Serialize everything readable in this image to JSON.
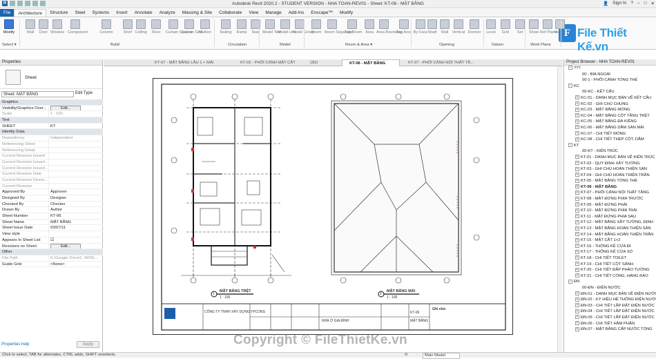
{
  "window": {
    "title": "Autodesk Revit 2020.2 - STUDENT VERSION - NHA TOAN-REV01 - Sheet: KT-06 - MẶT BẰNG",
    "sign_in": "Sign In"
  },
  "menu": [
    "File",
    "Architecture",
    "Structure",
    "Steel",
    "Systems",
    "Insert",
    "Annotate",
    "Analyze",
    "Massing & Site",
    "Collaborate",
    "View",
    "Manage",
    "Add-Ins",
    "Enscape™",
    "Modify"
  ],
  "ribbon": {
    "tools": [
      "Modify",
      "Wall",
      "Door",
      "Window",
      "Component",
      "Column",
      "Roof",
      "Ceiling",
      "Floor",
      "Curtain System",
      "Curtain Grid",
      "Mullion",
      "Railing",
      "Ramp",
      "Stair",
      "Model Text",
      "Model Line",
      "Model Group",
      "Room",
      "Room Separator",
      "Tag Room",
      "Area",
      "Area Boundary",
      "Tag Area",
      "By Face",
      "Shaft",
      "Wall",
      "Vertical",
      "Dormer",
      "Level",
      "Grid",
      "Set",
      "Show",
      "Ref Plane",
      "Viewer"
    ],
    "panels": [
      "Select ▾",
      "Build",
      "Circulation",
      "Model",
      "Room & Area ▾",
      "Opening",
      "Datum",
      "Work Plane"
    ]
  },
  "logo": {
    "letter": "F",
    "text": "File Thiết Kế.vn"
  },
  "properties": {
    "header": "Properties",
    "type_name": "Sheet",
    "selector": "Sheet: MẶT BẰNG",
    "edit_type": "Edit Type",
    "rows": [
      {
        "k": "Graphics",
        "v": "",
        "grp": true
      },
      {
        "k": "Visibility/Graphics Over...",
        "v": "Edit...",
        "btn": true
      },
      {
        "k": "Scale",
        "v": "1 : 100",
        "dis": true
      },
      {
        "k": "Text",
        "v": "",
        "grp": true
      },
      {
        "k": "SHEET",
        "v": "KT"
      },
      {
        "k": "Identity Data",
        "v": "",
        "grp": true
      },
      {
        "k": "Dependency",
        "v": "Independent",
        "dis": true
      },
      {
        "k": "Referencing Sheet",
        "v": "",
        "dis": true
      },
      {
        "k": "Referencing Detail",
        "v": "",
        "dis": true
      },
      {
        "k": "Current Revision Issued",
        "v": "",
        "dis": true
      },
      {
        "k": "Current Revision Issued ...",
        "v": "",
        "dis": true
      },
      {
        "k": "Current Revision Issued ...",
        "v": "",
        "dis": true
      },
      {
        "k": "Current Revision Date",
        "v": "",
        "dis": true
      },
      {
        "k": "Current Revision Descri...",
        "v": "",
        "dis": true
      },
      {
        "k": "Current Revision",
        "v": "",
        "dis": true
      },
      {
        "k": "Approved By",
        "v": "Approver"
      },
      {
        "k": "Designed By",
        "v": "Designer"
      },
      {
        "k": "Checked By",
        "v": "Checker"
      },
      {
        "k": "Drawn By",
        "v": "Author"
      },
      {
        "k": "Sheet Number",
        "v": "KT-06"
      },
      {
        "k": "Sheet Name",
        "v": "MẶT BẰNG"
      },
      {
        "k": "Sheet Issue Date",
        "v": "03/07/11"
      },
      {
        "k": "View style",
        "v": ""
      },
      {
        "k": "Appears In Sheet List",
        "v": "☑"
      },
      {
        "k": "Revisions on Sheet",
        "v": "Edit...",
        "btn": true
      },
      {
        "k": "Other",
        "v": "",
        "grp": true
      },
      {
        "k": "File Path",
        "v": "E:\\Google Drive\\1. WOR...",
        "dis": true
      },
      {
        "k": "Guide Grid",
        "v": "<None>"
      }
    ],
    "help": "Properties help",
    "apply": "Apply"
  },
  "tabs": [
    {
      "label": "KT-07 - MẶT BẰNG LẦU 1 + MÁI",
      "active": false
    },
    {
      "label": "KT-02 - PHỐI CẢNH MẶT CẮT",
      "active": false
    },
    {
      "label": "{3D}",
      "active": false
    },
    {
      "label": "KT-06 - MẶT BẰNG",
      "active": true
    },
    {
      "label": "KT-07 - PHỐI CẢNH NỘI THẤT TẦ...",
      "active": false
    }
  ],
  "sheet": {
    "plan1_title": "MẶT BẰNG TRỆT",
    "plan1_scale": "1 : 100",
    "plan1_num": "1",
    "plan2_title": "MẶT BẰNG MÁI",
    "plan2_scale": "1 : 100",
    "plan2_num": "2",
    "company": "CÔNG TY TNHH XÂY DỰNG TPCONS",
    "project": "NHÀ Ở GIA ĐÌNH",
    "sheet_name": "MẶT BẰNG",
    "sheet_no": "KT-06",
    "notes_head": "Ghi chú:"
  },
  "browser": {
    "header": "Project Browser - NHA TOAN-REV01",
    "items": [
      {
        "t": "???",
        "lvl": 0,
        "tg": "−"
      },
      {
        "t": "00 - BÌA NGOÀI",
        "lvl": 2
      },
      {
        "t": "00-1 - PHỐI CẢNH TỔNG THỂ",
        "lvl": 2
      },
      {
        "t": "KC",
        "lvl": 0,
        "tg": "−"
      },
      {
        "t": "00-KC - KẾT CẤU",
        "lvl": 2
      },
      {
        "t": "KC-01 - DANH MỤC BẢN VẼ KẾT CẤU",
        "lvl": 1,
        "tg": "+"
      },
      {
        "t": "KC-02 - GHI CHÚ CHUNG",
        "lvl": 1,
        "tg": "+"
      },
      {
        "t": "KC-03 - MẶT BẰNG MÓNG",
        "lvl": 1,
        "tg": "+"
      },
      {
        "t": "KC-04 - MẶT BẰNG CỘT TẦNG TRỆT",
        "lvl": 1,
        "tg": "+"
      },
      {
        "t": "KC-05 - MẶT BẰNG ĐÀ KIỀNG",
        "lvl": 1,
        "tg": "+"
      },
      {
        "t": "KC-06 - MẶT BẰNG DẦM SÀN MÁI",
        "lvl": 1,
        "tg": "+"
      },
      {
        "t": "KC-07 - CHI TIẾT MÓNG",
        "lvl": 1,
        "tg": "+"
      },
      {
        "t": "KC-08 - CHI TIẾT THÉP CỘT, DẦM",
        "lvl": 1,
        "tg": "+"
      },
      {
        "t": "KT",
        "lvl": 0,
        "tg": "−"
      },
      {
        "t": "00-KT - KIẾN TRÚC",
        "lvl": 2
      },
      {
        "t": "KT-01 - DANH MỤC BẢN VẼ KIẾN TRÚC",
        "lvl": 1,
        "tg": "+"
      },
      {
        "t": "KT-02 - QUY ĐỊNH XÂY TƯỜNG",
        "lvl": 1,
        "tg": "+"
      },
      {
        "t": "KT-03 - GHI CHÚ HOÀN THIỆN SÀN",
        "lvl": 1,
        "tg": "+"
      },
      {
        "t": "KT-04 - GHI CHÚ HOÀN THIỆN TRẦN",
        "lvl": 1,
        "tg": "+"
      },
      {
        "t": "KT-05 - MẶT BẰNG TỔNG THỂ",
        "lvl": 1,
        "tg": "+"
      },
      {
        "t": "KT-06 - MẶT BẰNG",
        "lvl": 1,
        "tg": "+",
        "b": true
      },
      {
        "t": "KT-07 - PHỐI CẢNH NỘI THẤT TẦNG",
        "lvl": 1,
        "tg": "+"
      },
      {
        "t": "KT-08 - MẶT ĐỨNG PHÍA TRƯỚC",
        "lvl": 1,
        "tg": "+"
      },
      {
        "t": "KT-09 - MẶT ĐỨNG PHẢI",
        "lvl": 1,
        "tg": "+"
      },
      {
        "t": "KT-10 - MẶT ĐỨNG PHÍA TRÁI",
        "lvl": 1,
        "tg": "+"
      },
      {
        "t": "KT-11 - MẶT ĐỨNG PHÍA SAU",
        "lvl": 1,
        "tg": "+"
      },
      {
        "t": "KT-12 - MẶT BẰNG XÂY TƯỜNG, ĐỊNH",
        "lvl": 1,
        "tg": "+"
      },
      {
        "t": "KT-13 - MẶT BẰNG HOÀN THIỆN SÀN",
        "lvl": 1,
        "tg": "+"
      },
      {
        "t": "KT-14 - MẶT BẰNG HOÀN THIỆN TRẦN",
        "lvl": 1,
        "tg": "+"
      },
      {
        "t": "KT-15 - MẶT CẮT 1+2",
        "lvl": 1,
        "tg": "+"
      },
      {
        "t": "KT-16 - THỐNG KÊ CỬA ĐI",
        "lvl": 1,
        "tg": "+"
      },
      {
        "t": "KT-17 - THỐNG KÊ CỬA SỔ",
        "lvl": 1,
        "tg": "+"
      },
      {
        "t": "KT-18 - CHI TIẾT TOILET",
        "lvl": 1,
        "tg": "+"
      },
      {
        "t": "KT-19 - CHI TIẾT CỘT SẢNH",
        "lvl": 1,
        "tg": "+"
      },
      {
        "t": "KT-20 - CHI TIẾT ĐẮP PHÀO TƯỜNG",
        "lvl": 1,
        "tg": "+"
      },
      {
        "t": "KT-21 - CHI TIẾT CỔNG, HÀNG RÀO",
        "lvl": 1,
        "tg": "+"
      },
      {
        "t": "ĐN",
        "lvl": 0,
        "tg": "−"
      },
      {
        "t": "00-ĐN - ĐIỆN NƯỚC",
        "lvl": 2
      },
      {
        "t": "ĐN-01 - DANH MỤC BẢN VẼ ĐIỆN NƯỚC",
        "lvl": 1,
        "tg": "+"
      },
      {
        "t": "ĐN-02 - KÝ HIỆU HỆ THỐNG ĐIỆN NƯỚC",
        "lvl": 1,
        "tg": "+"
      },
      {
        "t": "ĐN-03 - CHI TIẾT LẮP ĐẶT ĐIỆN NƯỚC",
        "lvl": 1,
        "tg": "+"
      },
      {
        "t": "ĐN-04 - CHI TIẾT LẮP ĐẶT ĐIỆN NƯỚC",
        "lvl": 1,
        "tg": "+"
      },
      {
        "t": "ĐN-05 - CHI TIẾT LẮP ĐẶT ĐIỆN NƯỚC",
        "lvl": 1,
        "tg": "+"
      },
      {
        "t": "ĐN-06 - CHI TIẾT HẦM PHÂN",
        "lvl": 1,
        "tg": "+"
      },
      {
        "t": "ĐN-07 - MẶT BẰNG CẤP NƯỚC TỔNG",
        "lvl": 1,
        "tg": "+"
      }
    ]
  },
  "status": {
    "hint": "Click to select, TAB for alternates, CTRL adds, SHIFT unselects.",
    "zoom": ":0",
    "model": "Main Model"
  },
  "watermark": "Copyright © FileThietKe.vn"
}
